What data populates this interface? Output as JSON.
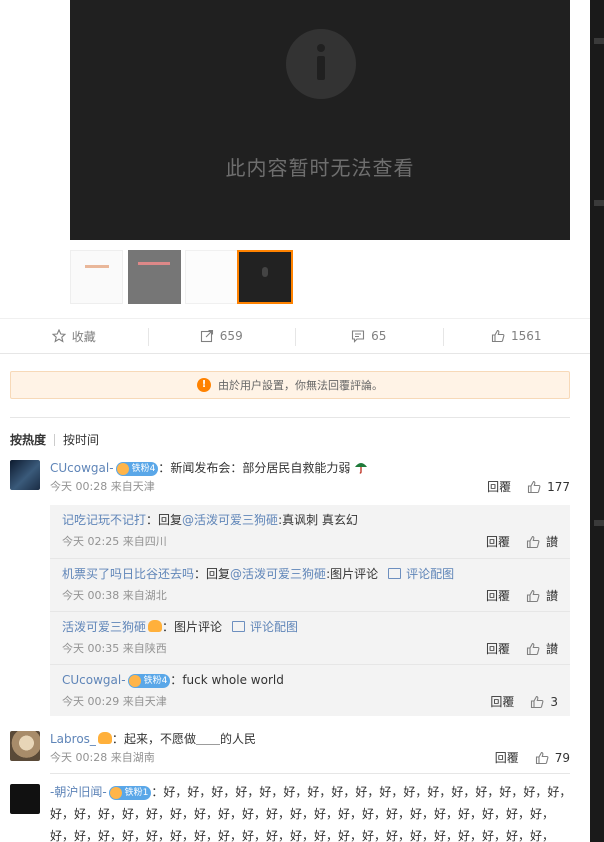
{
  "media": {
    "message": "此内容暂时无法查看"
  },
  "actions": {
    "favorite": "收藏",
    "reposts": "659",
    "comments": "65",
    "likes": "1561"
  },
  "notice": "由於用户設置，你無法回覆評論。",
  "sort": {
    "hot": "按热度",
    "time": "按时间"
  },
  "comments": [
    {
      "user": "CUcowgal-",
      "badge": "铁粉4",
      "sep": "：",
      "text": "新闻发布会：部分居民自救能力弱",
      "meta": "今天 00:28 来自天津",
      "reply": "回覆",
      "likes": "177",
      "replies": [
        {
          "user": "记吃记玩不记打",
          "sep": "：",
          "pre": "回复",
          "mention": "@活泼可爱三狗砸",
          "text": ":真讽刺 真玄幻",
          "meta": "今天 02:25 来自四川",
          "reply": "回覆",
          "likes": "讃"
        },
        {
          "user": "机票买了吗日比谷还去吗",
          "sep": "：",
          "pre": "回复",
          "mention": "@活泼可爱三狗砸",
          "text": ":图片评论",
          "img_link": "评论配图",
          "meta": "今天 00:38 来自湖北",
          "reply": "回覆",
          "likes": "讃"
        },
        {
          "user": "活泼可爱三狗砸",
          "sep": "：",
          "text": "图片评论",
          "img_link": "评论配图",
          "meta": "今天 00:35 来自陕西",
          "reply": "回覆",
          "likes": "讃"
        },
        {
          "user": "CUcowgal-",
          "badge": "铁粉4",
          "sep": "：",
          "text": "fuck whole world",
          "meta": "今天 00:29 来自天津",
          "reply": "回覆",
          "likes": "3"
        }
      ]
    },
    {
      "user": "Labros_",
      "sep": "：",
      "text": "起来，不愿做＿＿的人民",
      "meta": "今天 00:28 来自湖南",
      "reply": "回覆",
      "likes": "79"
    },
    {
      "user": "-朝沪旧闻-",
      "badge": "铁粉1",
      "sep": "：",
      "line1": "好，好，好，好，好，好，好，好，好，好，好，好，好，好，好，好，好，好，",
      "line2": "好，好，好，好，好，好，好，好，好，好，好，好，好，好，好，好，好，好，好，好，好，",
      "line3": "好，好，好，好，好，好，好，好，好，好，好，好，好，好，好，好，好，好，好，好，好，"
    }
  ],
  "colors": {
    "accent": "#ff8200",
    "link": "#5f85b8",
    "notice_bg": "#fff3e6",
    "badge": "#5aa7e8"
  }
}
